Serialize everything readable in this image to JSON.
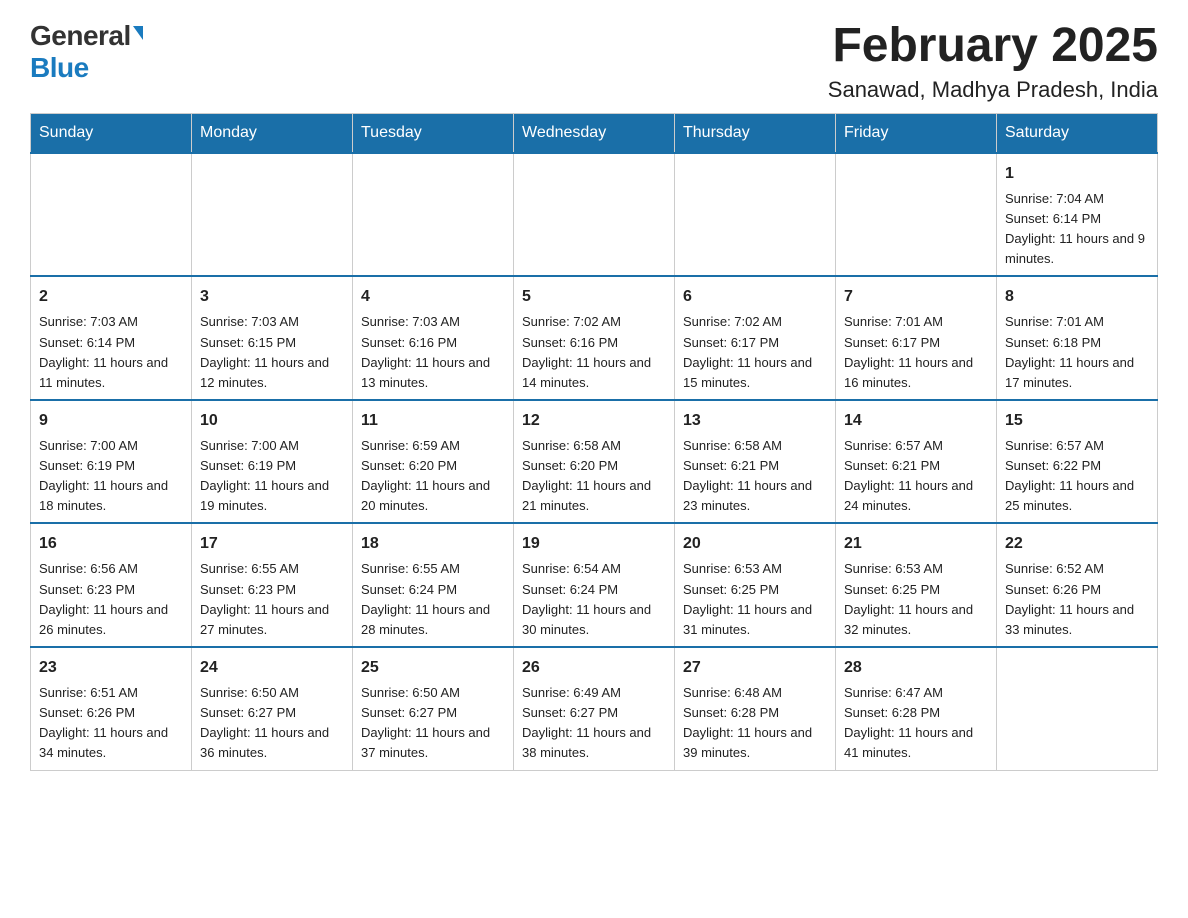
{
  "logo": {
    "general": "General",
    "blue": "Blue"
  },
  "title": "February 2025",
  "location": "Sanawad, Madhya Pradesh, India",
  "days_of_week": [
    "Sunday",
    "Monday",
    "Tuesday",
    "Wednesday",
    "Thursday",
    "Friday",
    "Saturday"
  ],
  "weeks": [
    [
      {
        "day": "",
        "info": ""
      },
      {
        "day": "",
        "info": ""
      },
      {
        "day": "",
        "info": ""
      },
      {
        "day": "",
        "info": ""
      },
      {
        "day": "",
        "info": ""
      },
      {
        "day": "",
        "info": ""
      },
      {
        "day": "1",
        "info": "Sunrise: 7:04 AM\nSunset: 6:14 PM\nDaylight: 11 hours and 9 minutes."
      }
    ],
    [
      {
        "day": "2",
        "info": "Sunrise: 7:03 AM\nSunset: 6:14 PM\nDaylight: 11 hours and 11 minutes."
      },
      {
        "day": "3",
        "info": "Sunrise: 7:03 AM\nSunset: 6:15 PM\nDaylight: 11 hours and 12 minutes."
      },
      {
        "day": "4",
        "info": "Sunrise: 7:03 AM\nSunset: 6:16 PM\nDaylight: 11 hours and 13 minutes."
      },
      {
        "day": "5",
        "info": "Sunrise: 7:02 AM\nSunset: 6:16 PM\nDaylight: 11 hours and 14 minutes."
      },
      {
        "day": "6",
        "info": "Sunrise: 7:02 AM\nSunset: 6:17 PM\nDaylight: 11 hours and 15 minutes."
      },
      {
        "day": "7",
        "info": "Sunrise: 7:01 AM\nSunset: 6:17 PM\nDaylight: 11 hours and 16 minutes."
      },
      {
        "day": "8",
        "info": "Sunrise: 7:01 AM\nSunset: 6:18 PM\nDaylight: 11 hours and 17 minutes."
      }
    ],
    [
      {
        "day": "9",
        "info": "Sunrise: 7:00 AM\nSunset: 6:19 PM\nDaylight: 11 hours and 18 minutes."
      },
      {
        "day": "10",
        "info": "Sunrise: 7:00 AM\nSunset: 6:19 PM\nDaylight: 11 hours and 19 minutes."
      },
      {
        "day": "11",
        "info": "Sunrise: 6:59 AM\nSunset: 6:20 PM\nDaylight: 11 hours and 20 minutes."
      },
      {
        "day": "12",
        "info": "Sunrise: 6:58 AM\nSunset: 6:20 PM\nDaylight: 11 hours and 21 minutes."
      },
      {
        "day": "13",
        "info": "Sunrise: 6:58 AM\nSunset: 6:21 PM\nDaylight: 11 hours and 23 minutes."
      },
      {
        "day": "14",
        "info": "Sunrise: 6:57 AM\nSunset: 6:21 PM\nDaylight: 11 hours and 24 minutes."
      },
      {
        "day": "15",
        "info": "Sunrise: 6:57 AM\nSunset: 6:22 PM\nDaylight: 11 hours and 25 minutes."
      }
    ],
    [
      {
        "day": "16",
        "info": "Sunrise: 6:56 AM\nSunset: 6:23 PM\nDaylight: 11 hours and 26 minutes."
      },
      {
        "day": "17",
        "info": "Sunrise: 6:55 AM\nSunset: 6:23 PM\nDaylight: 11 hours and 27 minutes."
      },
      {
        "day": "18",
        "info": "Sunrise: 6:55 AM\nSunset: 6:24 PM\nDaylight: 11 hours and 28 minutes."
      },
      {
        "day": "19",
        "info": "Sunrise: 6:54 AM\nSunset: 6:24 PM\nDaylight: 11 hours and 30 minutes."
      },
      {
        "day": "20",
        "info": "Sunrise: 6:53 AM\nSunset: 6:25 PM\nDaylight: 11 hours and 31 minutes."
      },
      {
        "day": "21",
        "info": "Sunrise: 6:53 AM\nSunset: 6:25 PM\nDaylight: 11 hours and 32 minutes."
      },
      {
        "day": "22",
        "info": "Sunrise: 6:52 AM\nSunset: 6:26 PM\nDaylight: 11 hours and 33 minutes."
      }
    ],
    [
      {
        "day": "23",
        "info": "Sunrise: 6:51 AM\nSunset: 6:26 PM\nDaylight: 11 hours and 34 minutes."
      },
      {
        "day": "24",
        "info": "Sunrise: 6:50 AM\nSunset: 6:27 PM\nDaylight: 11 hours and 36 minutes."
      },
      {
        "day": "25",
        "info": "Sunrise: 6:50 AM\nSunset: 6:27 PM\nDaylight: 11 hours and 37 minutes."
      },
      {
        "day": "26",
        "info": "Sunrise: 6:49 AM\nSunset: 6:27 PM\nDaylight: 11 hours and 38 minutes."
      },
      {
        "day": "27",
        "info": "Sunrise: 6:48 AM\nSunset: 6:28 PM\nDaylight: 11 hours and 39 minutes."
      },
      {
        "day": "28",
        "info": "Sunrise: 6:47 AM\nSunset: 6:28 PM\nDaylight: 11 hours and 41 minutes."
      },
      {
        "day": "",
        "info": ""
      }
    ]
  ]
}
